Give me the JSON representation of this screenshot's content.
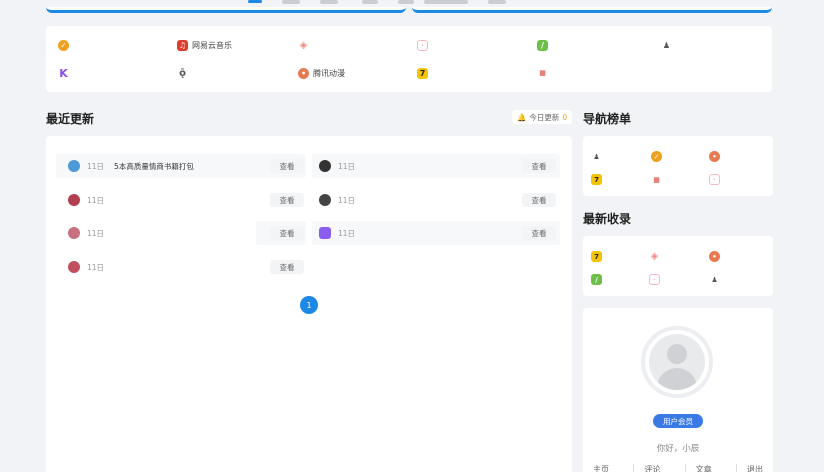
{
  "sites": [
    {
      "name": "",
      "icon": "orange-badge-icon",
      "color": "#f0a020"
    },
    {
      "name": "网易云音乐",
      "icon": "netease-music-icon",
      "color": "#e13b2b"
    },
    {
      "name": "",
      "icon": "diamond-icon",
      "color": "#f08a80"
    },
    {
      "name": "",
      "icon": "pig-icon",
      "color": "#f6b8c0"
    },
    {
      "name": "",
      "icon": "leaf-icon",
      "color": "#6cc04a"
    },
    {
      "name": "",
      "icon": "character-icon",
      "color": "#555555"
    },
    {
      "name": "",
      "icon": "k-logo-icon",
      "color": "#8a4ff0"
    },
    {
      "name": "",
      "icon": "q-logo-icon",
      "color": "#555555"
    },
    {
      "name": "腾讯动漫",
      "icon": "tencent-comic-icon",
      "color": "#e87a50"
    },
    {
      "name": "",
      "icon": "seven-logo-icon",
      "color": "#f5c400"
    },
    {
      "name": "",
      "icon": "xiaodao-logo-icon",
      "color": "#d33b2f"
    }
  ],
  "recent": {
    "title": "最近更新",
    "today_label": "今日更新",
    "today_count": "0",
    "view_label": "查看",
    "left": [
      {
        "day": "11日",
        "title": "5本高质量情商书籍打包",
        "color": "#4a9bd8"
      },
      {
        "day": "11日",
        "title": "",
        "color": "#b04050"
      },
      {
        "day": "11日",
        "title": "",
        "color": "#c87080"
      },
      {
        "day": "11日",
        "title": "",
        "color": "#c05060"
      }
    ],
    "right": [
      {
        "day": "11日",
        "title": "",
        "color": "#333333"
      },
      {
        "day": "11日",
        "title": "",
        "color": "#444444"
      },
      {
        "day": "11日",
        "title": "",
        "color": "#8a5cf0"
      }
    ],
    "page": "1"
  },
  "nav_ranking": {
    "title": "导航榜单",
    "items": [
      {
        "icon": "character-icon",
        "color": "#555555"
      },
      {
        "icon": "orange-badge-icon",
        "color": "#f0a020"
      },
      {
        "icon": "tencent-comic-icon",
        "color": "#e87a50"
      },
      {
        "icon": "seven-logo-icon",
        "color": "#f5c400"
      },
      {
        "icon": "xiaodao-logo-icon",
        "color": "#d33b2f"
      },
      {
        "icon": "pig-icon",
        "color": "#f6b8c0"
      }
    ]
  },
  "latest": {
    "title": "最新收录",
    "items": [
      {
        "icon": "seven-logo-icon",
        "color": "#f5c400"
      },
      {
        "icon": "diamond-icon",
        "color": "#f08a80"
      },
      {
        "icon": "tencent-comic-icon",
        "color": "#e87a50"
      },
      {
        "icon": "leaf-icon",
        "color": "#6cc04a"
      },
      {
        "icon": "pig-icon",
        "color": "#f6b8c0"
      },
      {
        "icon": "character-icon",
        "color": "#555555"
      }
    ]
  },
  "user": {
    "member_label": "用户会员",
    "greeting": "你好，小辰",
    "links": [
      "主页",
      "评论",
      "文章",
      "退出"
    ]
  },
  "accent": "#1e88e5"
}
